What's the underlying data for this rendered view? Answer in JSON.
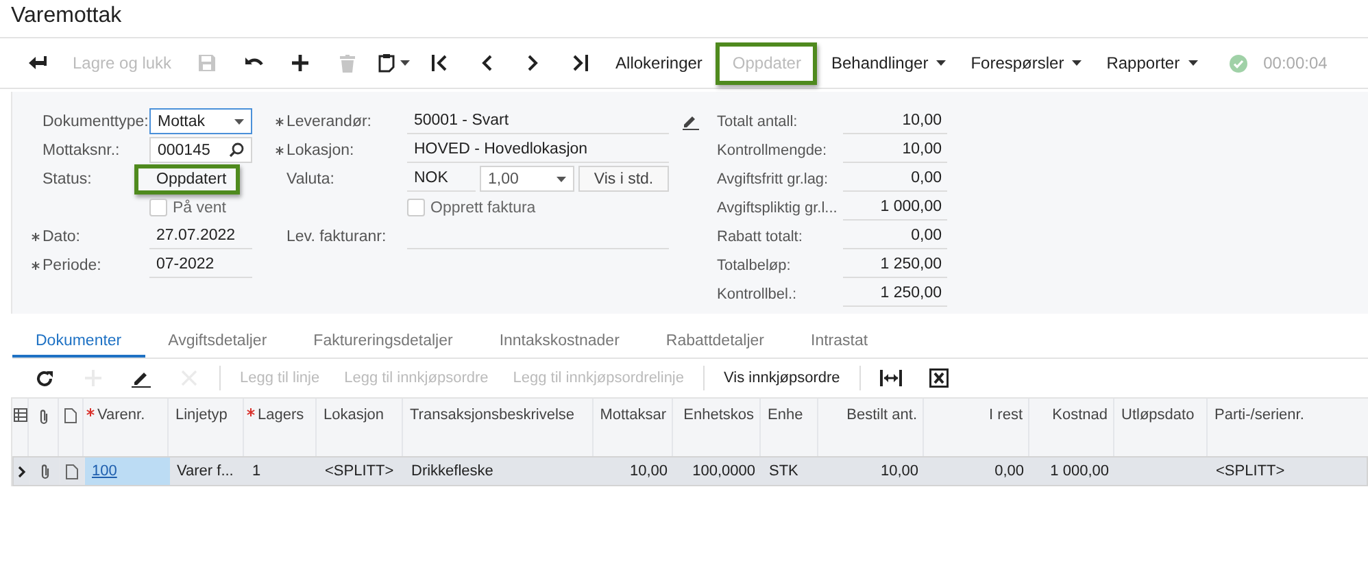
{
  "window": {
    "title": "Varemottak"
  },
  "toolbar": [
    {
      "kind": "icon",
      "disabled": false
    },
    {
      "kind": "button",
      "label": "Lagre og lukk",
      "disabled": true
    },
    {
      "kind": "icon",
      "disabled": true
    },
    {
      "kind": "icon",
      "disabled": false
    },
    {
      "kind": "icon",
      "disabled": false
    },
    {
      "kind": "icon",
      "disabled": true
    },
    {
      "kind": "icon-menu",
      "disabled": false
    },
    {
      "kind": "icon",
      "disabled": false
    },
    {
      "kind": "icon",
      "disabled": false
    },
    {
      "kind": "icon",
      "disabled": false
    },
    {
      "kind": "icon",
      "disabled": false
    },
    {
      "kind": "button",
      "label": "Allokeringer",
      "disabled": false
    },
    {
      "kind": "button",
      "label": "Oppdater",
      "disabled": true,
      "highlighted": true
    },
    {
      "kind": "menu",
      "label": "Behandlinger",
      "disabled": false
    },
    {
      "kind": "menu",
      "label": "Forespørsler",
      "disabled": false
    },
    {
      "kind": "menu",
      "label": "Rapporter",
      "disabled": false
    },
    {
      "kind": "status",
      "disabled": true
    },
    {
      "kind": "timer",
      "label": "00:00:04",
      "disabled": true
    }
  ],
  "form": {
    "columns": [
      {
        "fields": [
          {
            "kind": "select",
            "label": "Dokumenttype:",
            "value": "Mottak",
            "required": false,
            "focused": true
          },
          {
            "kind": "search",
            "label": "Mottaksnr.:",
            "value": "000145",
            "required": false
          },
          {
            "kind": "text",
            "label": "Status:",
            "value": "Oppdatert",
            "required": false,
            "highlighted": true
          },
          {
            "kind": "checkbox",
            "label": "På vent",
            "checked": false
          },
          {
            "kind": "text",
            "label": "Dato:",
            "value": "27.07.2022",
            "required": true
          },
          {
            "kind": "text",
            "label": "Periode:",
            "value": "07-2022",
            "required": true
          }
        ]
      },
      {
        "fields": [
          {
            "kind": "edit",
            "label": "Leverandør:",
            "value": "50001 - Svart",
            "required": true
          },
          {
            "kind": "text",
            "label": "Lokasjon:",
            "value": "HOVED - Hovedlokasjon",
            "required": true
          },
          {
            "kind": "currency",
            "label": "Valuta:",
            "value": "NOK",
            "rate": "1,00",
            "button": "Vis i std.",
            "required": false
          },
          {
            "kind": "checkbox",
            "label": "Opprett faktura",
            "checked": false
          },
          {
            "kind": "text",
            "label": "Lev. fakturanr:",
            "required": false
          }
        ]
      }
    ],
    "totals": [
      {
        "label": "Totalt antall:",
        "value": "10,00"
      },
      {
        "label": "Kontrollmengde:",
        "value": "10,00"
      },
      {
        "label": "Avgiftsfritt gr.lag:",
        "value": "0,00"
      },
      {
        "label": "Avgiftspliktig gr.l...",
        "value": "1 000,00"
      },
      {
        "label": "Rabatt totalt:",
        "value": "0,00"
      },
      {
        "label": "Totalbeløp:",
        "value": "1 250,00"
      },
      {
        "label": "Kontrollbel.:",
        "value": "1 250,00"
      }
    ]
  },
  "tabs": [
    {
      "label": "Dokumenter",
      "selected": true
    },
    {
      "label": "Avgiftsdetaljer",
      "selected": false
    },
    {
      "label": "Faktureringsdetaljer",
      "selected": false
    },
    {
      "label": "Inntakskostnader",
      "selected": false
    },
    {
      "label": "Rabattdetaljer",
      "selected": false
    },
    {
      "label": "Intrastat",
      "selected": false
    }
  ],
  "grid_toolbar": [
    {
      "kind": "icon",
      "disabled": false
    },
    {
      "kind": "icon",
      "disabled": true
    },
    {
      "kind": "icon",
      "disabled": false
    },
    {
      "kind": "icon",
      "disabled": true
    },
    {
      "kind": "separator"
    },
    {
      "kind": "button",
      "label": "Legg til linje",
      "disabled": true
    },
    {
      "kind": "button",
      "label": "Legg til innkjøpsordre",
      "disabled": true
    },
    {
      "kind": "button",
      "label": "Legg til innkjøpsordrelinje",
      "disabled": true
    },
    {
      "kind": "separator"
    },
    {
      "kind": "button",
      "label": "Vis innkjøpsordre",
      "disabled": false
    },
    {
      "kind": "separator"
    },
    {
      "kind": "icon",
      "disabled": false
    },
    {
      "kind": "icon",
      "disabled": false
    }
  ],
  "table": {
    "columns": [
      {
        "label": "Varenr.",
        "required": true
      },
      {
        "label": "Linjetyp",
        "required": false
      },
      {
        "label": "Lagers",
        "required": true
      },
      {
        "label": "Lokasjon",
        "required": false
      },
      {
        "label": "Transaksjonsbeskrivelse",
        "required": false
      },
      {
        "label": "Mottaksar",
        "required": false
      },
      {
        "label": "Enhetskos",
        "required": false
      },
      {
        "label": "Enhe",
        "required": false
      },
      {
        "label": "Bestilt ant.",
        "required": false
      },
      {
        "label": "I rest",
        "required": false
      },
      {
        "label": "Kostnad",
        "required": false
      },
      {
        "label": "Utløpsdato",
        "required": false
      },
      {
        "label": "Parti-/serienr.",
        "required": false
      }
    ],
    "rows": [
      {
        "selected": true,
        "cells": [
          {
            "text": "100",
            "kind": "link",
            "focused": true
          },
          {
            "text": "Varer f...",
            "kind": "text",
            "focused": false
          },
          {
            "text": "1",
            "kind": "text",
            "focused": false
          },
          {
            "text": "<SPLITT>",
            "kind": "text",
            "focused": false
          },
          {
            "text": "Drikkefleske",
            "kind": "text",
            "focused": false
          },
          {
            "text": "10,00",
            "kind": "text",
            "focused": false
          },
          {
            "text": "100,0000",
            "kind": "text",
            "focused": false
          },
          {
            "text": "STK",
            "kind": "text",
            "focused": false
          },
          {
            "text": "10,00",
            "kind": "text",
            "focused": false
          },
          {
            "text": "0,00",
            "kind": "text",
            "focused": false
          },
          {
            "text": "1 000,00",
            "kind": "text",
            "focused": false
          },
          null,
          {
            "text": "<SPLITT>",
            "kind": "text",
            "focused": false
          }
        ]
      }
    ]
  }
}
